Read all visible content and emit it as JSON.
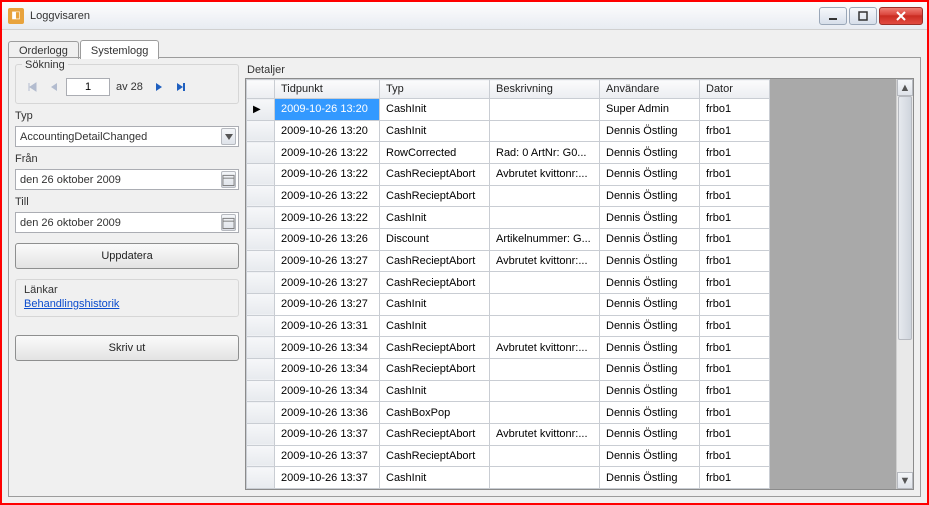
{
  "window": {
    "title": "Loggvisaren"
  },
  "tabs": [
    {
      "label": "Orderlogg",
      "active": false
    },
    {
      "label": "Systemlogg",
      "active": true
    }
  ],
  "search": {
    "group_label": "Sökning",
    "page_value": "1",
    "page_total_text": "av 28",
    "typ_label": "Typ",
    "typ_value": "AccountingDetailChanged",
    "fran_label": "Från",
    "fran_value": "den 26  oktober   2009",
    "till_label": "Till",
    "till_value": "den 26  oktober   2009",
    "update_button": "Uppdatera",
    "links_label": "Länkar",
    "link_text": "Behandlingshistorik",
    "print_button": "Skriv ut"
  },
  "details": {
    "panel_title": "Detaljer",
    "columns": [
      "Tidpunkt",
      "Typ",
      "Beskrivning",
      "Användare",
      "Dator"
    ],
    "rows": [
      {
        "t": "2009-10-26 13:20",
        "typ": "CashInit",
        "b": "",
        "u": "Super Admin",
        "d": "frbo1",
        "selected": true
      },
      {
        "t": "2009-10-26 13:20",
        "typ": "CashInit",
        "b": "",
        "u": "Dennis Östling",
        "d": "frbo1"
      },
      {
        "t": "2009-10-26 13:22",
        "typ": "RowCorrected",
        "b": "Rad: 0 ArtNr: G0...",
        "u": "Dennis Östling",
        "d": "frbo1"
      },
      {
        "t": "2009-10-26 13:22",
        "typ": "CashRecieptAbort",
        "b": "Avbrutet kvittonr:...",
        "u": "Dennis Östling",
        "d": "frbo1"
      },
      {
        "t": "2009-10-26 13:22",
        "typ": "CashRecieptAbort",
        "b": "",
        "u": "Dennis Östling",
        "d": "frbo1"
      },
      {
        "t": "2009-10-26 13:22",
        "typ": "CashInit",
        "b": "",
        "u": "Dennis Östling",
        "d": "frbo1"
      },
      {
        "t": "2009-10-26 13:26",
        "typ": "Discount",
        "b": "Artikelnummer: G...",
        "u": "Dennis Östling",
        "d": "frbo1"
      },
      {
        "t": "2009-10-26 13:27",
        "typ": "CashRecieptAbort",
        "b": "Avbrutet kvittonr:...",
        "u": "Dennis Östling",
        "d": "frbo1"
      },
      {
        "t": "2009-10-26 13:27",
        "typ": "CashRecieptAbort",
        "b": "",
        "u": "Dennis Östling",
        "d": "frbo1"
      },
      {
        "t": "2009-10-26 13:27",
        "typ": "CashInit",
        "b": "",
        "u": "Dennis Östling",
        "d": "frbo1"
      },
      {
        "t": "2009-10-26 13:31",
        "typ": "CashInit",
        "b": "",
        "u": "Dennis Östling",
        "d": "frbo1"
      },
      {
        "t": "2009-10-26 13:34",
        "typ": "CashRecieptAbort",
        "b": "Avbrutet kvittonr:...",
        "u": "Dennis Östling",
        "d": "frbo1"
      },
      {
        "t": "2009-10-26 13:34",
        "typ": "CashRecieptAbort",
        "b": "",
        "u": "Dennis Östling",
        "d": "frbo1"
      },
      {
        "t": "2009-10-26 13:34",
        "typ": "CashInit",
        "b": "",
        "u": "Dennis Östling",
        "d": "frbo1"
      },
      {
        "t": "2009-10-26 13:36",
        "typ": "CashBoxPop",
        "b": "",
        "u": "Dennis Östling",
        "d": "frbo1"
      },
      {
        "t": "2009-10-26 13:37",
        "typ": "CashRecieptAbort",
        "b": "Avbrutet kvittonr:...",
        "u": "Dennis Östling",
        "d": "frbo1"
      },
      {
        "t": "2009-10-26 13:37",
        "typ": "CashRecieptAbort",
        "b": "",
        "u": "Dennis Östling",
        "d": "frbo1"
      },
      {
        "t": "2009-10-26 13:37",
        "typ": "CashInit",
        "b": "",
        "u": "Dennis Östling",
        "d": "frbo1"
      }
    ]
  }
}
